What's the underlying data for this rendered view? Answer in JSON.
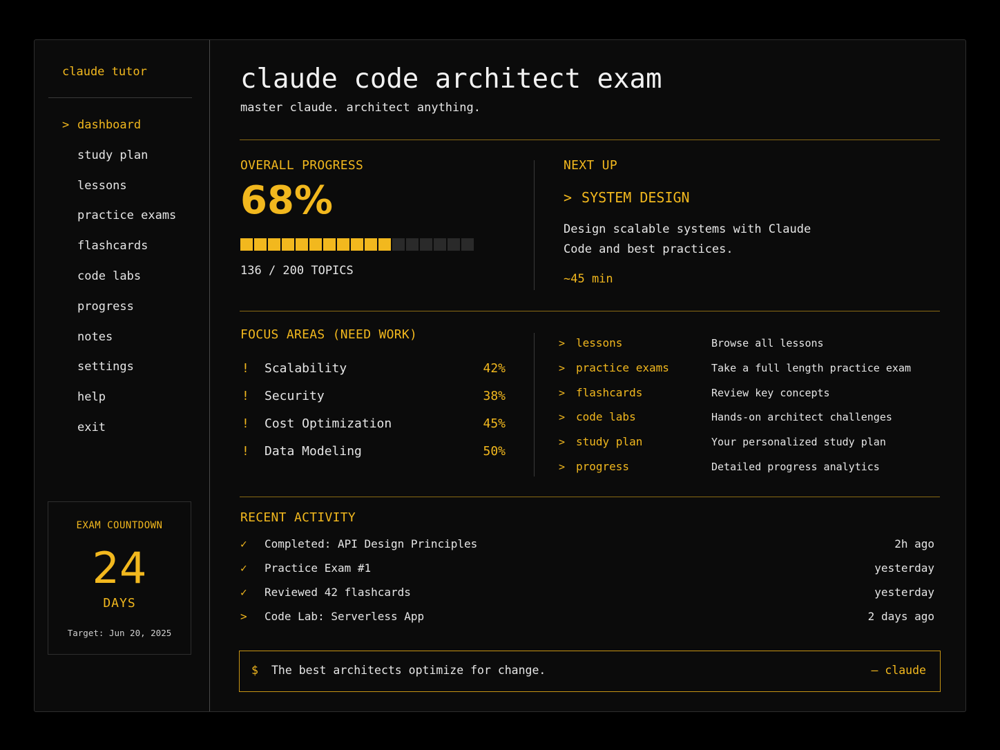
{
  "sidebar": {
    "brand": "claude tutor",
    "active_caret": ">",
    "items": [
      {
        "label": "dashboard"
      },
      {
        "label": "study plan"
      },
      {
        "label": "lessons"
      },
      {
        "label": "practice exams"
      },
      {
        "label": "flashcards"
      },
      {
        "label": "code labs"
      },
      {
        "label": "progress"
      },
      {
        "label": "notes"
      },
      {
        "label": "settings"
      },
      {
        "label": "help"
      },
      {
        "label": "exit"
      }
    ],
    "countdown": {
      "title": "EXAM COUNTDOWN",
      "value": "24",
      "unit": "DAYS",
      "target": "Target: Jun 20, 2025"
    }
  },
  "header": {
    "title": "claude code architect exam",
    "subtitle": "master claude. architect anything."
  },
  "progress": {
    "label": "OVERALL PROGRESS",
    "percent_text": "68%",
    "segments_filled": 11,
    "segments_total": 17,
    "topics": "136 / 200 TOPICS"
  },
  "next_up": {
    "label": "NEXT UP",
    "caret": ">",
    "title": "SYSTEM DESIGN",
    "description": "Design scalable systems with Claude Code and best practices.",
    "duration": "~45 min"
  },
  "focus": {
    "label": "FOCUS AREAS (NEED WORK)",
    "marker": "!",
    "items": [
      {
        "name": "Scalability",
        "pct": "42%"
      },
      {
        "name": "Security",
        "pct": "38%"
      },
      {
        "name": "Cost Optimization",
        "pct": "45%"
      },
      {
        "name": "Data Modeling",
        "pct": "50%"
      }
    ]
  },
  "quick_links": {
    "caret": ">",
    "items": [
      {
        "name": "lessons",
        "desc": "Browse all lessons"
      },
      {
        "name": "practice exams",
        "desc": "Take a full length practice exam"
      },
      {
        "name": "flashcards",
        "desc": "Review key concepts"
      },
      {
        "name": "code labs",
        "desc": "Hands-on architect challenges"
      },
      {
        "name": "study plan",
        "desc": "Your personalized study plan"
      },
      {
        "name": "progress",
        "desc": "Detailed progress analytics"
      }
    ]
  },
  "activity": {
    "label": "RECENT ACTIVITY",
    "items": [
      {
        "mark": "✓",
        "text": "Completed: API Design Principles",
        "time": "2h ago"
      },
      {
        "mark": "✓",
        "text": "Practice Exam #1",
        "time": "yesterday"
      },
      {
        "mark": "✓",
        "text": "Reviewed 42 flashcards",
        "time": "yesterday"
      },
      {
        "mark": ">",
        "text": "Code Lab: Serverless App",
        "time": "2 days ago"
      }
    ]
  },
  "quote": {
    "prompt": "$",
    "text": "The best architects optimize for change.",
    "author": "– claude"
  },
  "colors": {
    "accent": "#f2b81e",
    "background": "#0b0b0b",
    "text": "#e6e6e6",
    "empty_segment": "#2a2a2a"
  }
}
